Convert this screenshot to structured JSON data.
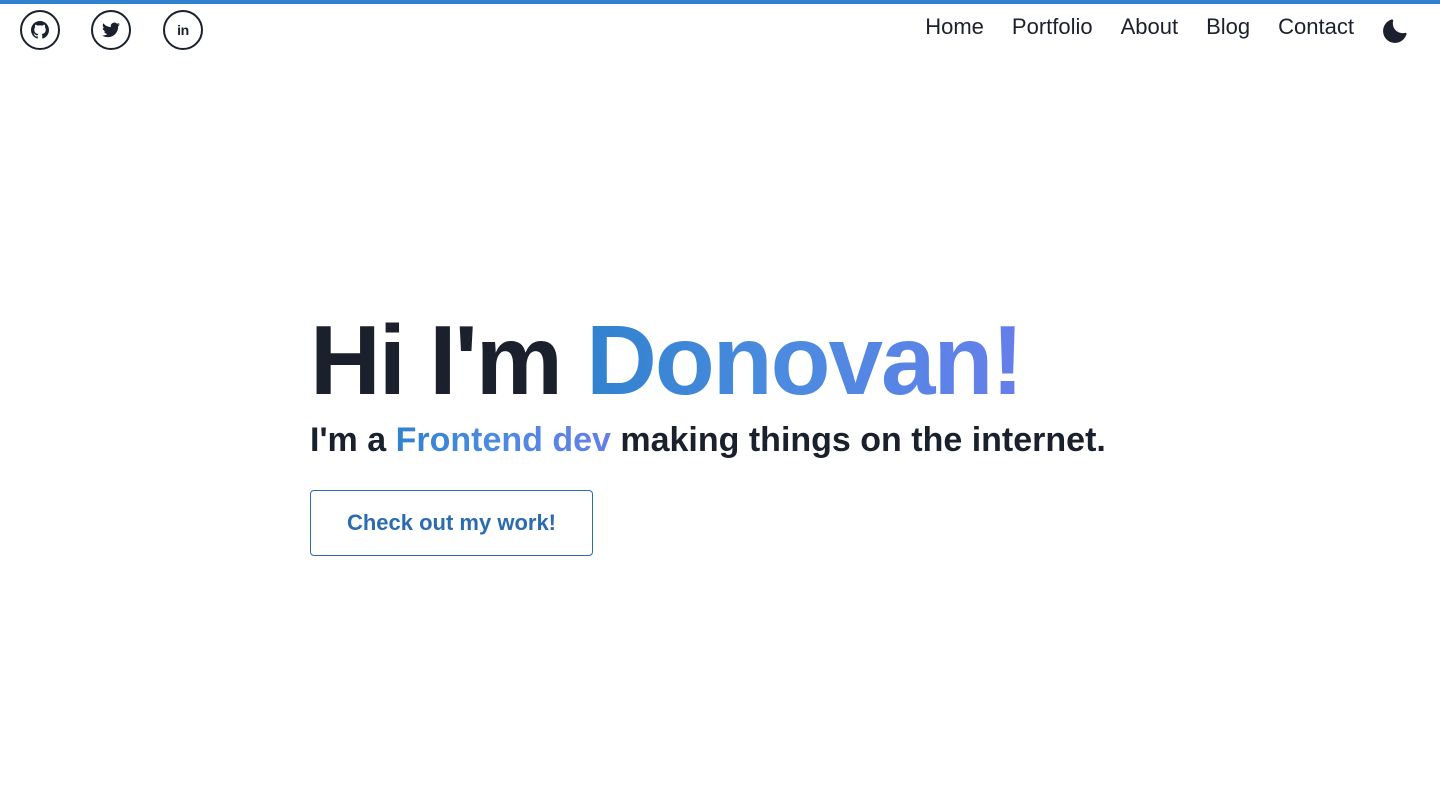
{
  "colors": {
    "accent": "#3182ce",
    "accent_end": "#667eea",
    "text": "#1a202c",
    "button_text": "#2b6cb0"
  },
  "social": {
    "github_icon": "github-icon",
    "twitter_icon": "twitter-icon",
    "linkedin_label": "in"
  },
  "nav": {
    "items": [
      {
        "label": "Home"
      },
      {
        "label": "Portfolio"
      },
      {
        "label": "About"
      },
      {
        "label": "Blog"
      },
      {
        "label": "Contact"
      }
    ],
    "theme_icon": "moon-icon"
  },
  "hero": {
    "greeting": "Hi I'm ",
    "name": "Donovan!",
    "subtitle_prefix": "I'm a ",
    "role": "Frontend dev",
    "subtitle_suffix": " making things on the internet.",
    "cta_label": "Check out my work!"
  }
}
